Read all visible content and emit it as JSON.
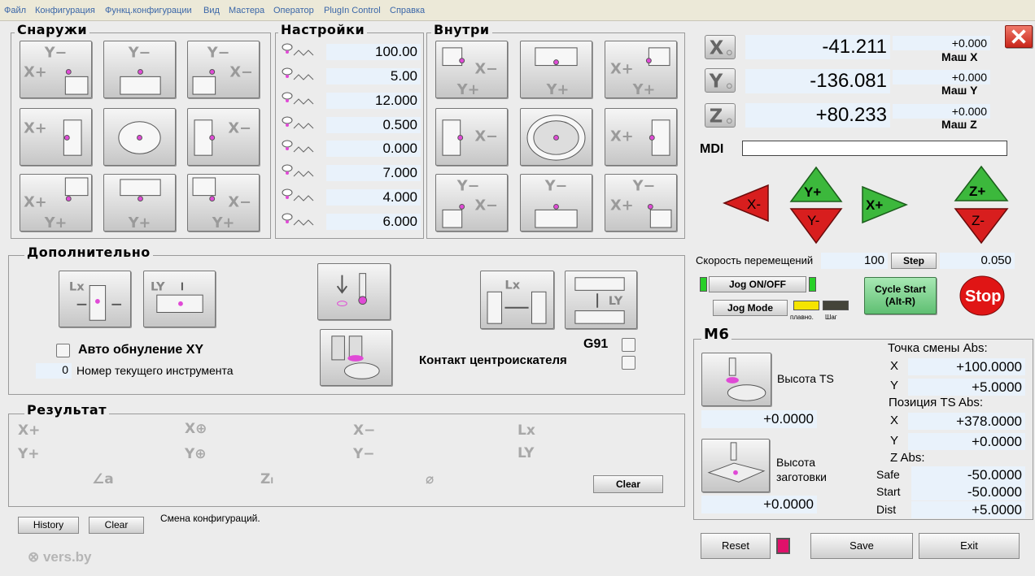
{
  "menu": {
    "items": [
      "Файл",
      "Конфигурация",
      "Функц.конфигурации",
      "Вид",
      "Мастера",
      "Оператор",
      "PlugIn Control",
      "Справка"
    ]
  },
  "groups": {
    "outside": "Снаружи",
    "settings": "Настройки",
    "inside": "Внутри",
    "additional": "Дополнительно",
    "result": "Результат",
    "m6": "M6"
  },
  "settings": {
    "values": [
      "100.00",
      "5.00",
      "12.000",
      "0.500",
      "0.000",
      "7.000",
      "4.000",
      "6.000"
    ]
  },
  "dro": {
    "x": "-41.211",
    "y": "-136.081",
    "z": "+80.233",
    "mx": "+0.000",
    "my": "+0.000",
    "mz": "+0.000",
    "mx_label": "Маш X",
    "my_label": "Маш Y",
    "mz_label": "Маш Z"
  },
  "mdi": {
    "label": "MDI",
    "value": ""
  },
  "jog": {
    "xminus": "X-",
    "xplus": "X+",
    "yplus": "Y+",
    "yminus": "Y-",
    "zplus": "Z+",
    "zminus": "Z-"
  },
  "speed": {
    "label": "Скорость перемещений",
    "value": "100",
    "step_label": "Step",
    "step_value": "0.050"
  },
  "buttons": {
    "jog_onoff": "Jog ON/OFF",
    "jog_mode": "Jog Mode",
    "cycle_start": "Cycle Start (Alt-R)",
    "stop": "Stop",
    "smooth": "плавно.",
    "step": "Шаг",
    "history": "History",
    "clear_bottom": "Clear",
    "clear_result": "Clear",
    "reset": "Reset",
    "save": "Save",
    "exit": "Exit"
  },
  "additional": {
    "auto_zero": "Авто обнуление XY",
    "tool_number": "0",
    "tool_label": "Номер текущего инструмента",
    "g91": "G91",
    "contact": "Контакт центроискателя"
  },
  "status": {
    "message": "Смена конфигураций."
  },
  "m6": {
    "ts_height": "Высота TS",
    "ts_height_value": "+0.0000",
    "workpiece_height": "Высота заготовки",
    "workpiece_value": "+0.0000",
    "change_point": "Точка смены Abs:",
    "cx": "+100.0000",
    "cy": "+5.0000",
    "ts_pos": "Позиция TS Abs:",
    "tx": "+378.0000",
    "ty": "+0.0000",
    "z_abs": "Z Abs:",
    "safe_label": "Safe",
    "safe": "-50.0000",
    "start_label": "Start",
    "start": "-50.0000",
    "dist_label": "Dist",
    "dist": "+5.0000",
    "x": "X",
    "y": "Y"
  },
  "logo": "vers.by",
  "colors": {
    "field": "#e9f2fb",
    "red": "#d81e1e",
    "green": "#3cb83c",
    "cycle": "#7ccf8a"
  }
}
